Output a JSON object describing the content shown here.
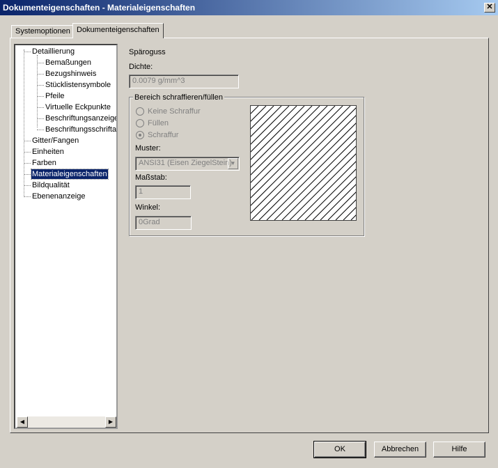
{
  "window": {
    "title": "Dokumenteigenschaften - Materialeigenschaften",
    "close": "✕"
  },
  "tabs": [
    {
      "label": "Systemoptionen",
      "selected": false
    },
    {
      "label": "Dokumenteigenschaften",
      "selected": true
    }
  ],
  "tree": [
    {
      "label": "Detaillierung",
      "level": 0
    },
    {
      "label": "Bemaßungen",
      "level": 1
    },
    {
      "label": "Bezugshinweis",
      "level": 1
    },
    {
      "label": "Stücklistensymbole",
      "level": 1
    },
    {
      "label": "Pfeile",
      "level": 1
    },
    {
      "label": "Virtuelle Eckpunkte",
      "level": 1
    },
    {
      "label": "Beschriftungsanzeige",
      "level": 1
    },
    {
      "label": "Beschriftungsschriftart",
      "level": 1
    },
    {
      "label": "Gitter/Fangen",
      "level": 0
    },
    {
      "label": "Einheiten",
      "level": 0
    },
    {
      "label": "Farben",
      "level": 0
    },
    {
      "label": "Materialeigenschaften",
      "level": 0,
      "selected": true
    },
    {
      "label": "Bildqualität",
      "level": 0
    },
    {
      "label": "Ebenenanzeige",
      "level": 0
    }
  ],
  "material": {
    "name": "Späroguss",
    "density_label": "Dichte:",
    "density_value": "0.0079 g/mm^3"
  },
  "hatch": {
    "group_label": "Bereich schraffieren/füllen",
    "radios": [
      {
        "label": "Keine Schraffur",
        "checked": false
      },
      {
        "label": "Füllen",
        "checked": false
      },
      {
        "label": "Schraffur",
        "checked": true
      }
    ],
    "pattern_label": "Muster:",
    "pattern_value": "ANSI31 (Eisen ZiegelStein)",
    "scale_label": "Maßstab:",
    "scale_value": "1",
    "angle_label": "Winkel:",
    "angle_value": "0Grad"
  },
  "buttons": {
    "ok": "OK",
    "cancel": "Abbrechen",
    "help": "Hilfe"
  }
}
